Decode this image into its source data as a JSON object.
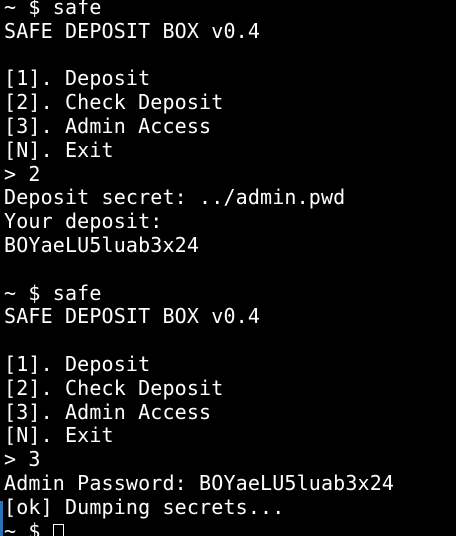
{
  "terminal": {
    "lines": [
      "~ $ safe",
      "SAFE DEPOSIT BOX v0.4",
      "",
      "[1]. Deposit",
      "[2]. Check Deposit",
      "[3]. Admin Access",
      "[N]. Exit",
      "> 2",
      "Deposit secret: ../admin.pwd",
      "Your deposit:",
      "BOYaeLU5luab3x24",
      "",
      "~ $ safe",
      "SAFE DEPOSIT BOX v0.4",
      "",
      "[1]. Deposit",
      "[2]. Check Deposit",
      "[3]. Admin Access",
      "[N]. Exit",
      "> 3",
      "Admin Password: BOYaeLU5luab3x24",
      "[ok] Dumping secrets..."
    ],
    "prompt": "~ $ "
  },
  "colors": {
    "background": "#000000",
    "foreground": "#ffffff",
    "gutter_mark": "#2d6fb8"
  }
}
